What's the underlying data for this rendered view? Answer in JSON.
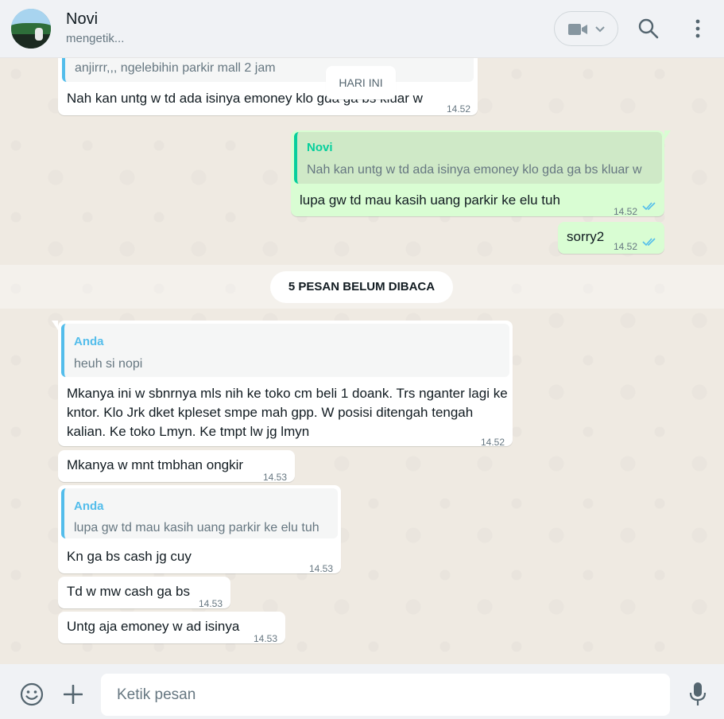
{
  "header": {
    "contact_name": "Novi",
    "status": "mengetik..."
  },
  "icons": {
    "video": "video-camera-icon",
    "search": "search-icon",
    "menu": "kebab-menu-icon",
    "emoji": "emoji-icon",
    "attach": "plus-icon",
    "mic": "microphone-icon"
  },
  "colors": {
    "outgoing_bubble": "#d9fdd3",
    "incoming_bubble": "#ffffff",
    "quote_in_accent": "#53bdeb",
    "quote_out_accent": "#06cf9c",
    "read_ticks": "#53bdeb"
  },
  "chat": {
    "day_label": "HARI INI",
    "unread_label": "5 PESAN BELUM DIBACA",
    "messages": [
      {
        "dir": "in",
        "quote_text": "anjirrr,,, ngelebihin parkir mall 2 jam",
        "text": "Nah kan untg w td ada isinya emoney klo gda ga bs kluar w",
        "time": "14.52"
      },
      {
        "dir": "out",
        "quote_name": "Novi",
        "quote_text": "Nah kan untg w td ada isinya emoney klo gda ga bs kluar w",
        "text": "lupa gw td mau kasih uang parkir ke elu tuh",
        "time": "14.52",
        "status": "read"
      },
      {
        "dir": "out",
        "text": "sorry2",
        "time": "14.52",
        "status": "read"
      },
      {
        "dir": "in",
        "quote_name": "Anda",
        "quote_text": "heuh si nopi",
        "text": "Mkanya ini w sbnrnya mls nih ke toko cm beli 1 doank. Trs nganter lagi ke kntor. Klo Jrk dket kpleset smpe mah gpp. W posisi ditengah tengah kalian. Ke toko Lmyn. Ke tmpt lw jg lmyn",
        "time": "14.52"
      },
      {
        "dir": "in",
        "text": "Mkanya w mnt tmbhan ongkir",
        "time": "14.53"
      },
      {
        "dir": "in",
        "quote_name": "Anda",
        "quote_text": "lupa gw td mau kasih uang parkir ke elu tuh",
        "text": "Kn ga bs cash jg cuy",
        "time": "14.53"
      },
      {
        "dir": "in",
        "text": "Td w mw cash ga bs",
        "time": "14.53"
      },
      {
        "dir": "in",
        "text": "Untg aja emoney w ad isinya",
        "time": "14.53"
      }
    ]
  },
  "footer": {
    "placeholder": "Ketik pesan"
  }
}
